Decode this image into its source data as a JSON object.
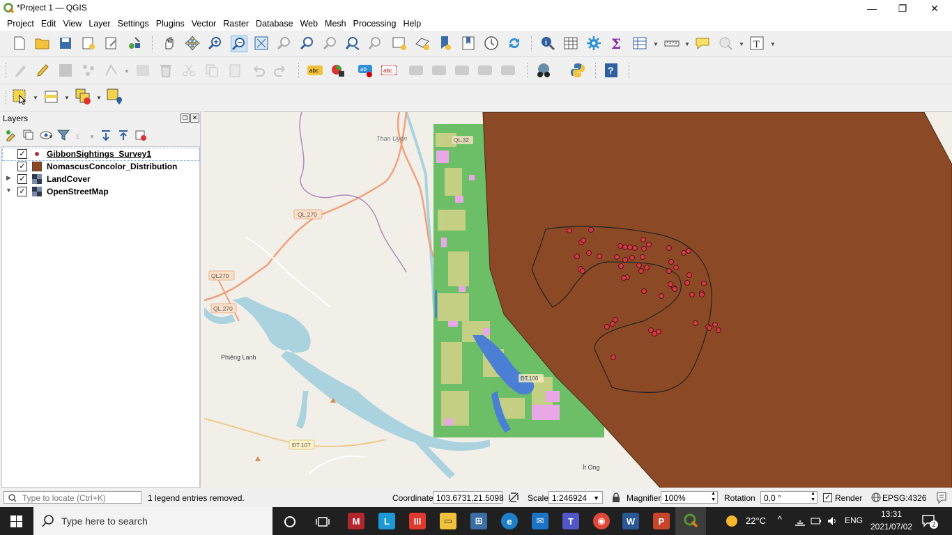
{
  "window": {
    "title": "*Project 1 — QGIS",
    "min_glyph": "—",
    "max_glyph": "❐",
    "close_glyph": "✕"
  },
  "menu": [
    "Project",
    "Edit",
    "View",
    "Layer",
    "Settings",
    "Plugins",
    "Vector",
    "Raster",
    "Database",
    "Web",
    "Mesh",
    "Processing",
    "Help"
  ],
  "layers_panel": {
    "title": "Layers",
    "layers": [
      {
        "name": "GibbonSightings_Survey1",
        "checked": true,
        "selected": true,
        "symbol": "point-symbol-icon",
        "expandable": false
      },
      {
        "name": "NomascusConcolor_Distribution",
        "checked": true,
        "selected": false,
        "symbol": "polygon-fill-icon",
        "expandable": false
      },
      {
        "name": "LandCover",
        "checked": true,
        "selected": false,
        "symbol": "raster-layer-icon",
        "expandable": true,
        "expanded": false
      },
      {
        "name": "OpenStreetMap",
        "checked": true,
        "selected": false,
        "symbol": "raster-layer-icon",
        "expandable": true,
        "expanded": true
      }
    ]
  },
  "map": {
    "labels": {
      "than_uyen": "Than Uyên",
      "ql32": "QL.32",
      "ql270_a": "QL.270",
      "ql270_b": "QL270",
      "ql270_c": "QL.270",
      "phieng_lanh": "Phiêng Lanh",
      "dt106": "ĐT.106",
      "dt107": "ĐT.107",
      "it_ong": "Ít Ong"
    },
    "colors": {
      "osm_bg": "#f2efe9",
      "water": "#aad3df",
      "landcover_green": "#6cbf67",
      "landcover_pink": "#e8a8e8",
      "landcover_blue": "#4a7fd4",
      "distribution": "#8b4a25",
      "sighting_fill": "#d23c46"
    }
  },
  "statusbar": {
    "locate_placeholder": "Type to locate (Ctrl+K)",
    "message": "1 legend entries removed.",
    "coordinate_label": "Coordinate",
    "coordinate_value": "103.6731,21.5098",
    "scale_label": "Scale",
    "scale_value": "1:246924",
    "magnifier_label": "Magnifier",
    "magnifier_value": "100%",
    "rotation_label": "Rotation",
    "rotation_value": "0,0 °",
    "render_label": "Render",
    "render_checked": true,
    "crs": "EPSG:4326"
  },
  "taskbar": {
    "search_placeholder": "Type here to search",
    "weather": "22°C",
    "language": "ENG",
    "time": "13:31",
    "date": "2021/07/02",
    "notification_count": "2"
  }
}
